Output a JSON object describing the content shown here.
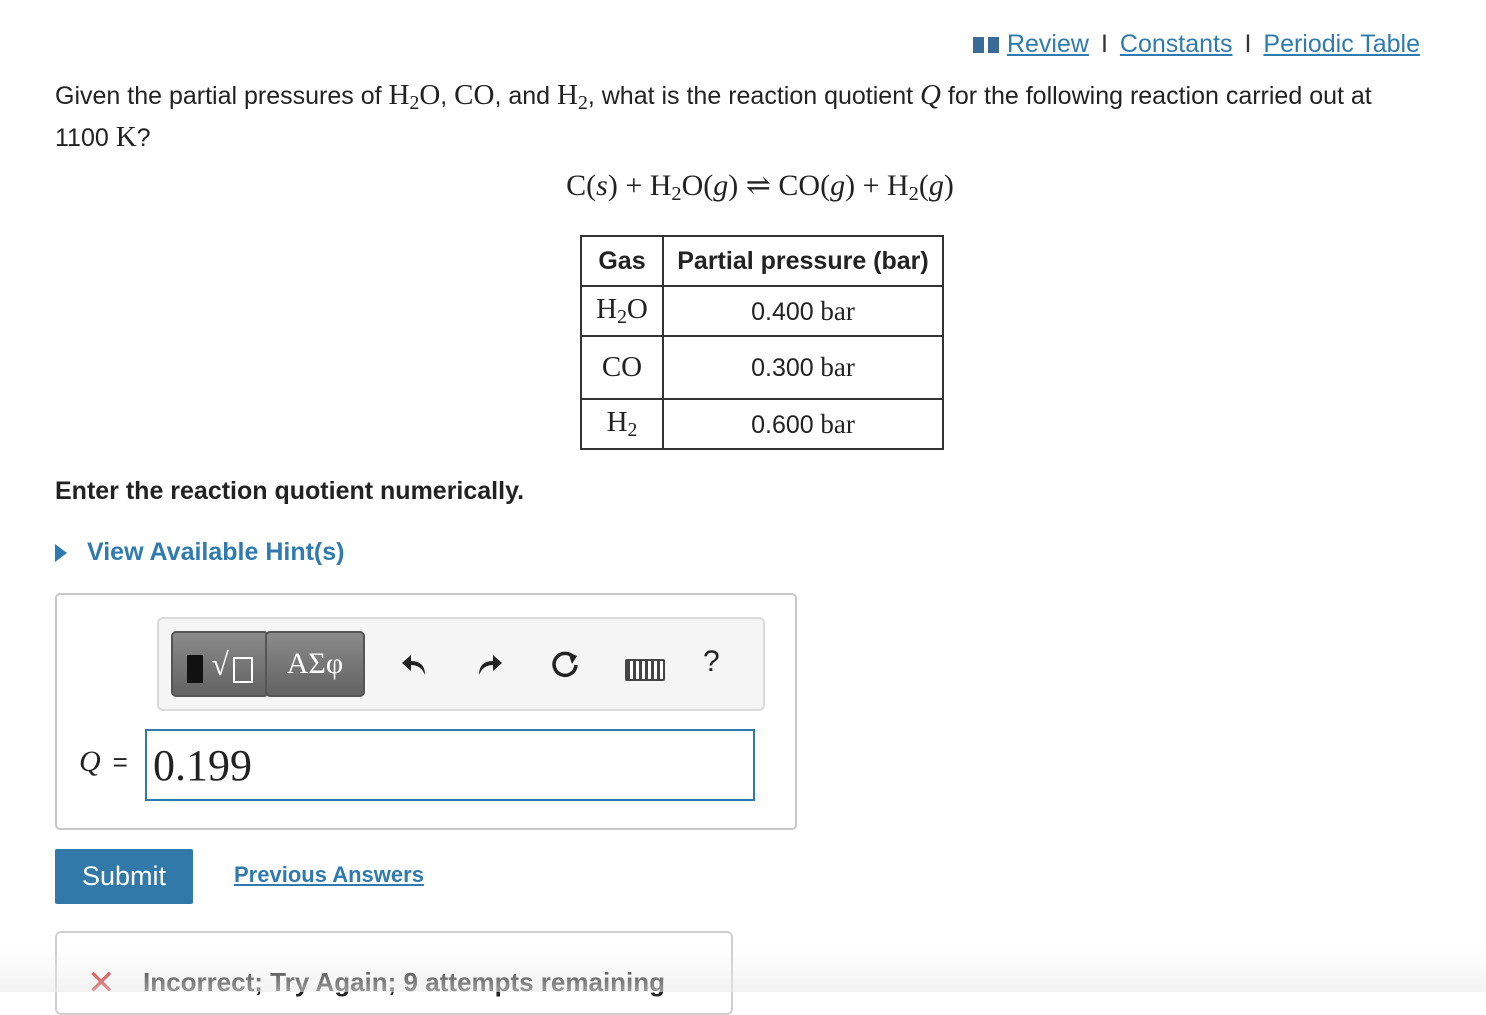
{
  "nav": {
    "icon": "book-icon",
    "review": "Review",
    "constants": "Constants",
    "periodic_table": "Periodic Table",
    "separator": "I"
  },
  "question": {
    "text_1": "Given the partial pressures of ",
    "h2o_H": "H",
    "h2o_sub": "2",
    "h2o_O": "O",
    "comma_1": ", ",
    "co": "CO",
    "and": ", and ",
    "h2_H": "H",
    "h2_sub": "2",
    "text_2": ", what is the reaction quotient ",
    "q": "Q",
    "text_3": " for the following reaction carried out at",
    "temp_value": "1100",
    "temp_unit": "K",
    "qmark": "?"
  },
  "equation": {
    "lhs1": "C(",
    "s": "s",
    "lhs2": ") + H",
    "sub1": "2",
    "lhs3": "O(",
    "g1": "g",
    "lhs4": ")",
    "arrow": "⇌",
    "rhs1": "CO(",
    "g2": "g",
    "rhs2": ") + H",
    "sub2": "2",
    "rhs3": "(",
    "g3": "g",
    "rhs4": ")"
  },
  "table": {
    "header_gas": "Gas",
    "header_pressure": "Partial pressure (bar)",
    "rows": [
      {
        "gas": "H",
        "sub": "2",
        "gas_rest": "O",
        "value": "0.400",
        "unit": "bar"
      },
      {
        "gas": "CO",
        "sub": "",
        "gas_rest": "",
        "value": "0.300",
        "unit": "bar"
      },
      {
        "gas": "H",
        "sub": "2",
        "gas_rest": "",
        "value": "0.600",
        "unit": "bar"
      }
    ]
  },
  "instruction": "Enter the reaction quotient numerically.",
  "hint": "View Available Hint(s)",
  "toolbar": {
    "template_icon": "sqrt-template-icon",
    "greek_label": "ΑΣφ",
    "undo_icon": "undo-icon",
    "redo_icon": "redo-icon",
    "reset_icon": "reset-icon",
    "keyboard_icon": "keyboard-icon",
    "help_label": "?"
  },
  "answer": {
    "label_var": "Q",
    "label_eq": "=",
    "value": "0.199"
  },
  "submit_label": "Submit",
  "previous_answers": "Previous Answers",
  "feedback": {
    "icon": "x-icon",
    "text": "Incorrect; Try Again; 9 attempts remaining"
  },
  "colors": {
    "link": "#2f7bb0",
    "submit_bg": "#3179a8",
    "error": "#c81e1e"
  }
}
